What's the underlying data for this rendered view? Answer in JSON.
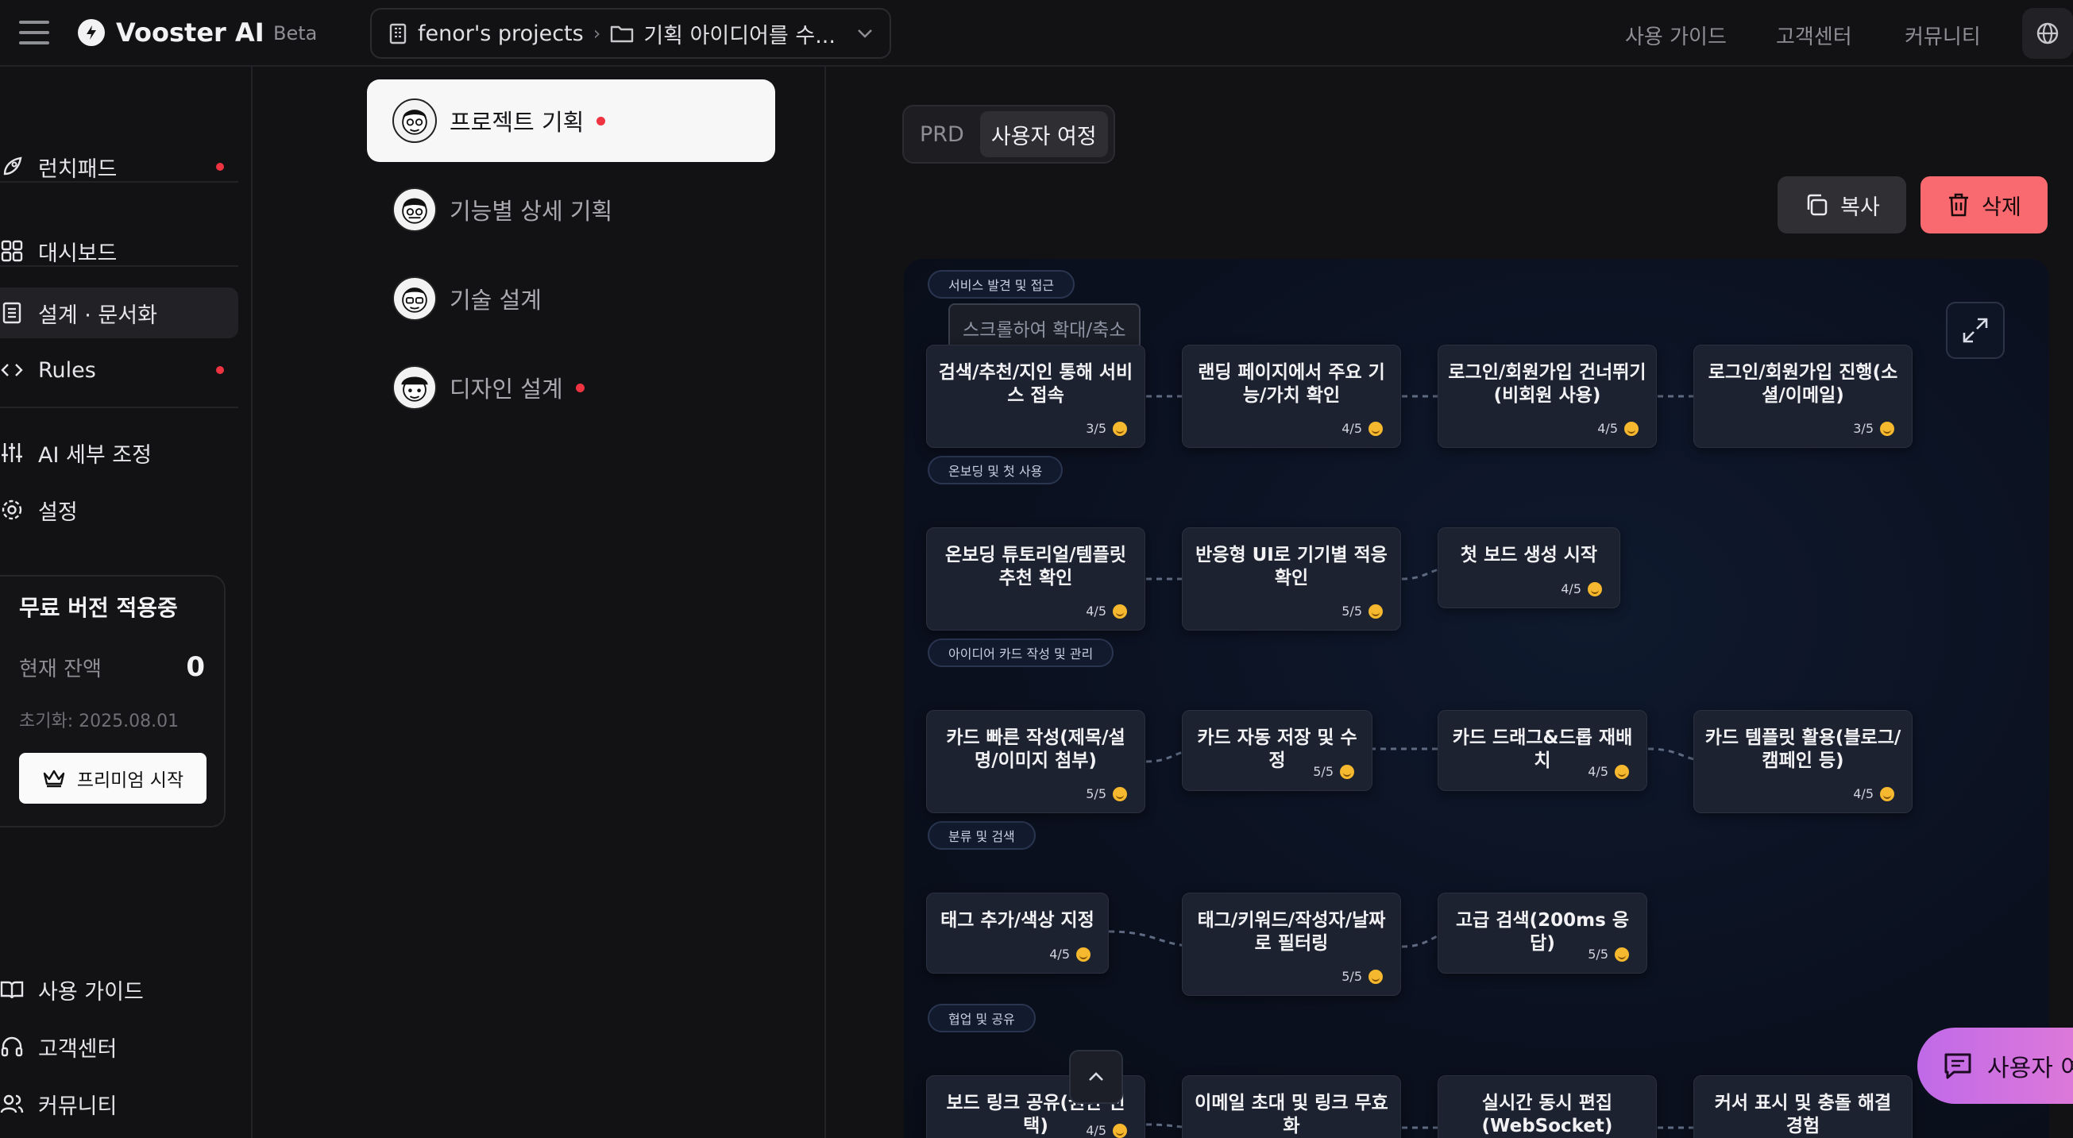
{
  "app": {
    "name": "Vooster AI",
    "badge": "Beta"
  },
  "breadcrumb": {
    "project": "fenor's projects",
    "item": "기획 아이디어를 수..."
  },
  "topnav": {
    "guide": "사용 가이드",
    "support": "고객센터",
    "community": "커뮤니티"
  },
  "sidebar": {
    "items": [
      {
        "label": "런치패드",
        "dot": true
      },
      {
        "label": "대시보드",
        "dot": false
      },
      {
        "label": "설계 · 문서화",
        "dot": false,
        "active": true
      },
      {
        "label": "Rules",
        "dot": true
      },
      {
        "label": "AI 세부 조정",
        "dot": false
      },
      {
        "label": "설정",
        "dot": false
      }
    ],
    "bottom": [
      "사용 가이드",
      "고객센터",
      "커뮤니티"
    ]
  },
  "plan": {
    "title": "무료 버전 적용중",
    "balance_label": "현재 잔액",
    "balance_value": "0",
    "reset": "초기화: 2025.08.01",
    "cta": "프리미엄 시작"
  },
  "docs": [
    {
      "label": "프로젝트 기획",
      "dot": true,
      "active": true
    },
    {
      "label": "기능별 상세 기획",
      "dot": false
    },
    {
      "label": "기술 설계",
      "dot": false
    },
    {
      "label": "디자인 설계",
      "dot": true
    }
  ],
  "tabs": [
    {
      "label": "PRD"
    },
    {
      "label": "사용자 여정",
      "active": true
    }
  ],
  "actions": {
    "copy": "복사",
    "delete": "삭제"
  },
  "canvas": {
    "zoom_hint": "스크롤하여 확대/축소",
    "stages": [
      "서비스 발견 및 접근",
      "온보딩 및 첫 사용",
      "아이디어 카드 작성 및 관리",
      "분류 및 검색",
      "협업 및 공유"
    ],
    "cards": [
      {
        "title": "검색/추천/지인 통해 서비스 접속",
        "score": "3/5"
      },
      {
        "title": "랜딩 페이지에서 주요 기능/가치 확인",
        "score": "4/5"
      },
      {
        "title": "로그인/회원가입 건너뛰기(비회원 사용)",
        "score": "4/5"
      },
      {
        "title": "로그인/회원가입 진행(소셜/이메일)",
        "score": "3/5"
      },
      {
        "title": "온보딩 튜토리얼/템플릿 추천 확인",
        "score": "4/5"
      },
      {
        "title": "반응형 UI로 기기별 적응 확인",
        "score": "5/5"
      },
      {
        "title": "첫 보드 생성 시작",
        "score": "4/5"
      },
      {
        "title": "카드 빠른 작성(제목/설명/이미지 첨부)",
        "score": "5/5"
      },
      {
        "title": "카드 자동 저장 및 수정",
        "score": "5/5"
      },
      {
        "title": "카드 드래그&드롭 재배치",
        "score": "4/5"
      },
      {
        "title": "카드 템플릿 활용(블로그/캠페인 등)",
        "score": "4/5"
      },
      {
        "title": "태그 추가/색상 지정",
        "score": "4/5"
      },
      {
        "title": "태그/키워드/작성자/날짜로 필터링",
        "score": "5/5"
      },
      {
        "title": "고급 검색(200ms 응답)",
        "score": "5/5"
      },
      {
        "title": "보드 링크 공유(권한 선택)",
        "score": "4/5"
      },
      {
        "title": "이메일 초대 및 링크 무효화",
        "score": ""
      },
      {
        "title": "실시간 동시 편집(WebSocket)",
        "score": ""
      },
      {
        "title": "커서 표시 및 충돌 해결 경험",
        "score": ""
      }
    ]
  },
  "chat": {
    "label": "사용자 여"
  },
  "colors": {
    "accent_red": "#ef3340",
    "delete_bg": "#f86a6f",
    "chat_gradient_start": "#c06ae8"
  }
}
